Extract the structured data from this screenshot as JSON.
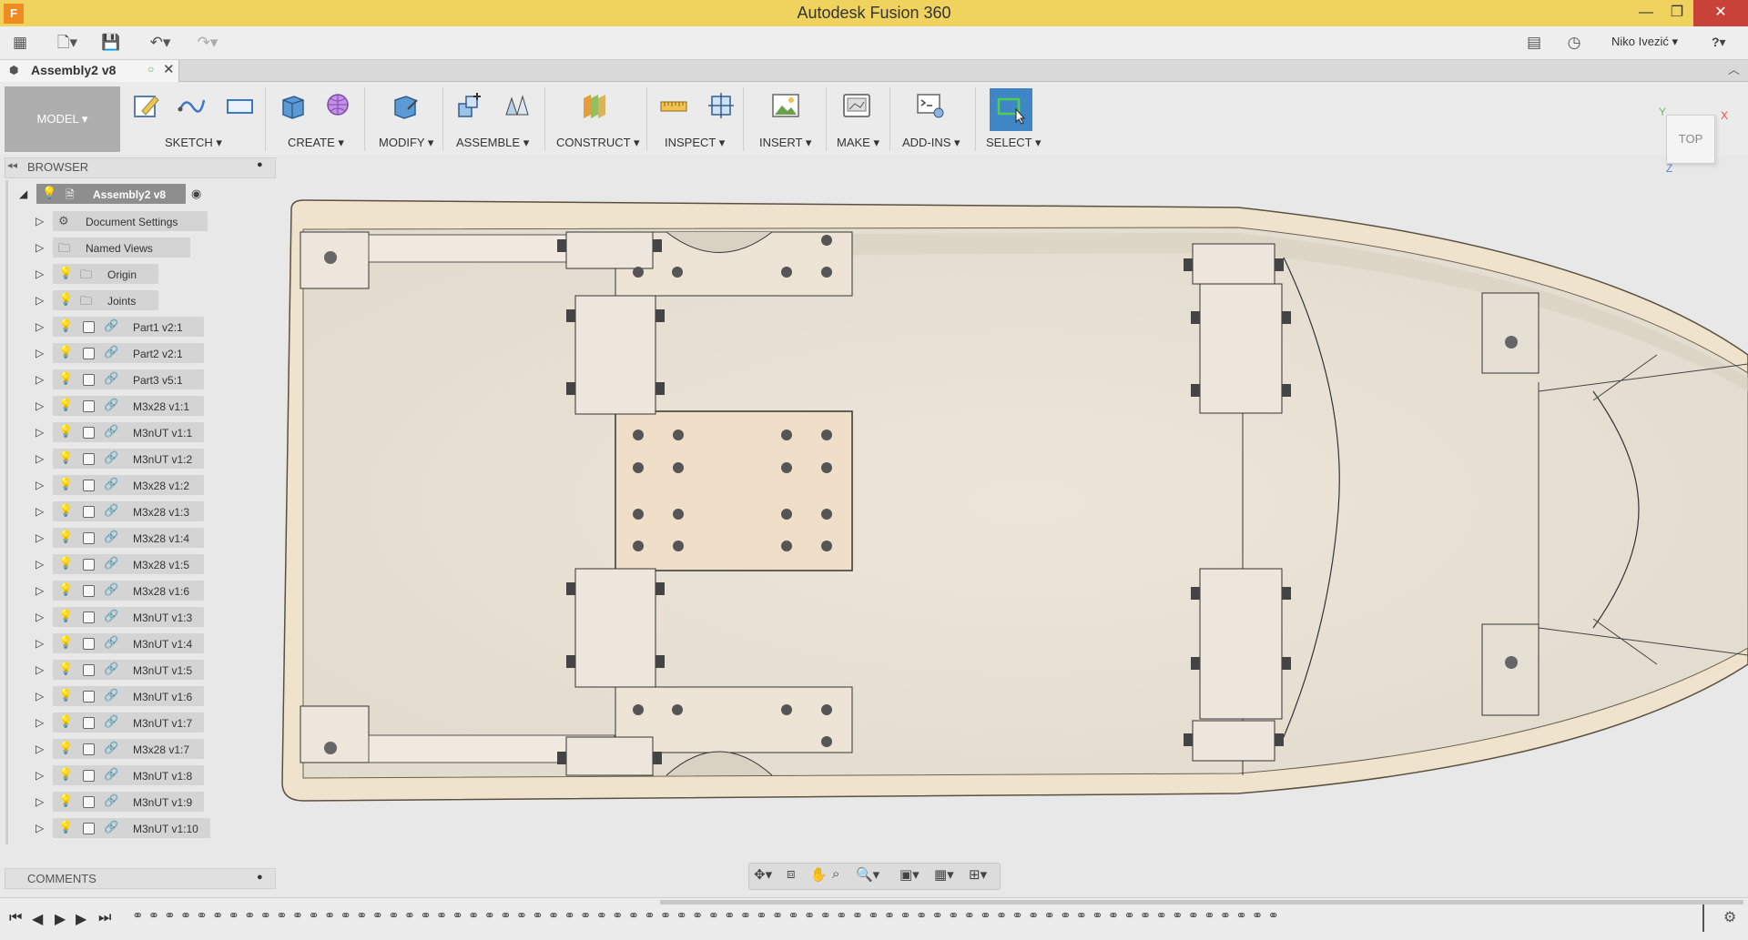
{
  "app": {
    "title": "Autodesk Fusion 360",
    "logo_letter": "F"
  },
  "window_controls": {
    "minimize": "—",
    "maximize": "❐",
    "close": "✕"
  },
  "quick_access": {
    "user_name": "Niko Ivezić ▾",
    "help": "?▾"
  },
  "document_tab": {
    "label": "Assembly2 v8"
  },
  "toolbar": {
    "workspace": "MODEL ▾",
    "groups": [
      {
        "label": "SKETCH ▾"
      },
      {
        "label": "CREATE ▾"
      },
      {
        "label": "MODIFY ▾"
      },
      {
        "label": "ASSEMBLE ▾"
      },
      {
        "label": "CONSTRUCT ▾"
      },
      {
        "label": "INSPECT ▾"
      },
      {
        "label": "INSERT ▾"
      },
      {
        "label": "MAKE ▾"
      },
      {
        "label": "ADD-INS ▾"
      },
      {
        "label": "SELECT ▾"
      }
    ]
  },
  "browser": {
    "title": "BROWSER",
    "root": "Assembly2 v8",
    "folders": [
      "Document Settings",
      "Named Views",
      "Origin",
      "Joints"
    ],
    "components": [
      "Part1 v2:1",
      "Part2 v2:1",
      "Part3 v5:1",
      "M3x28 v1:1",
      "M3nUT v1:1",
      "M3nUT v1:2",
      "M3x28 v1:2",
      "M3x28 v1:3",
      "M3x28 v1:4",
      "M3x28 v1:5",
      "M3x28 v1:6",
      "M3nUT v1:3",
      "M3nUT v1:4",
      "M3nUT v1:5",
      "M3nUT v1:6",
      "M3nUT v1:7",
      "M3x28 v1:7",
      "M3nUT v1:8",
      "M3nUT v1:9",
      "M3nUT v1:10"
    ]
  },
  "comments": {
    "title": "COMMENTS"
  },
  "viewcube": {
    "face": "TOP",
    "x_axis": "X",
    "y_axis": "Y",
    "z_axis": "Z"
  },
  "colors": {
    "title_bar": "#efd35e",
    "select_active": "#3f86c6",
    "model_body": "#f1e6d3"
  }
}
